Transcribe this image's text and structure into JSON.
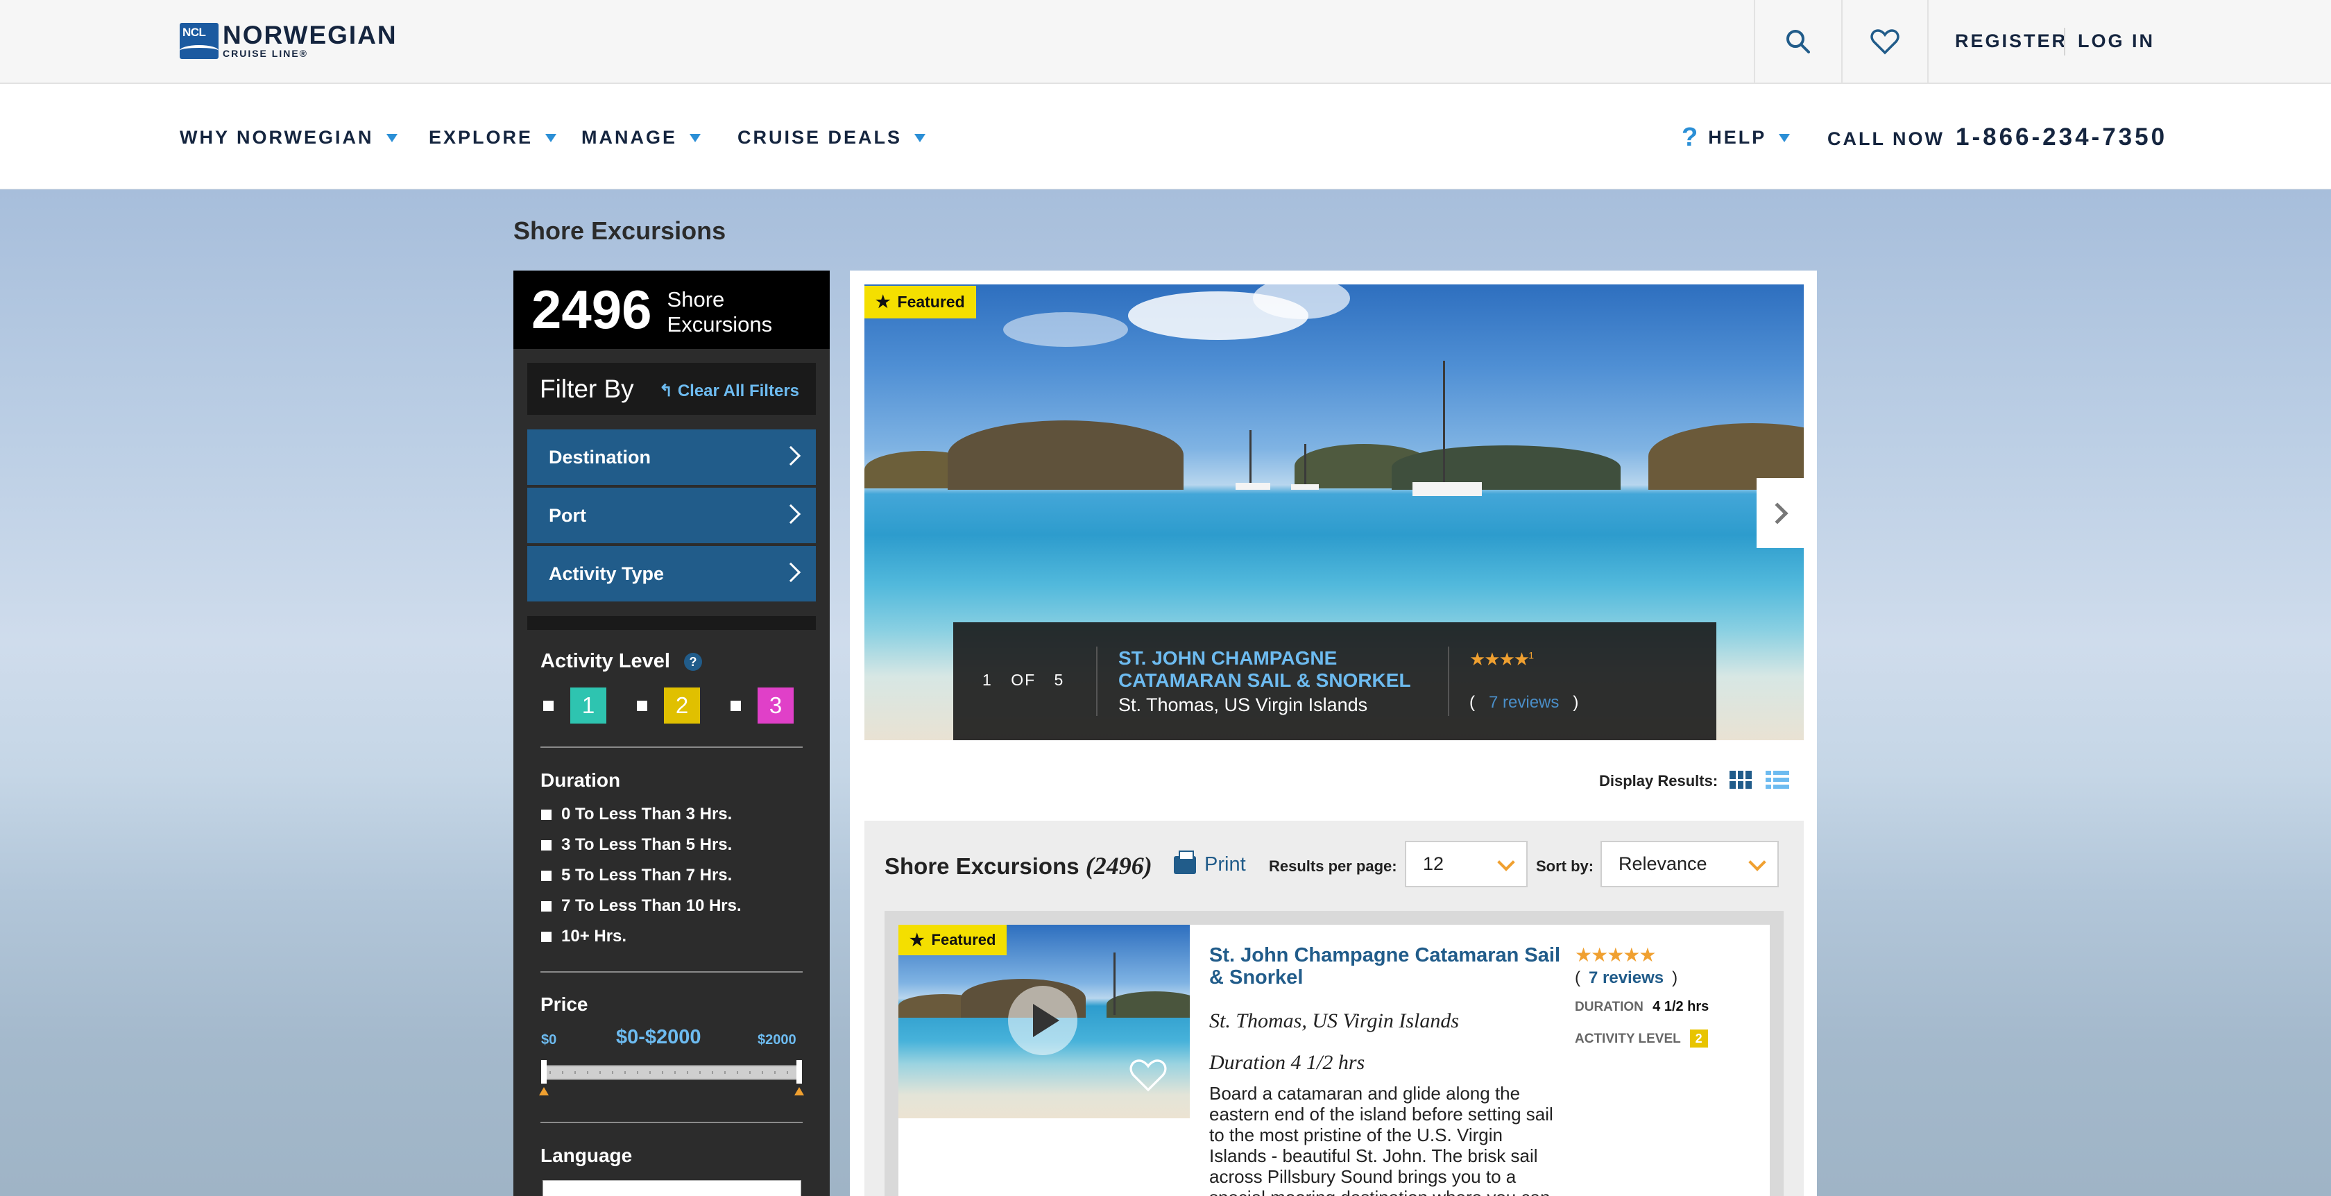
{
  "brand": {
    "badge": "NCL",
    "name": "NORWEGIAN",
    "tagline": "CRUISE LINE®"
  },
  "topbar": {
    "register": "REGISTER",
    "login": "LOG IN"
  },
  "nav": {
    "items": [
      {
        "label": "WHY NORWEGIAN"
      },
      {
        "label": "EXPLORE"
      },
      {
        "label": "MANAGE"
      },
      {
        "label": "CRUISE DEALS"
      }
    ],
    "help": "HELP",
    "call_label": "CALL NOW",
    "phone": "1-866-234-7350"
  },
  "page": {
    "title": "Shore Excursions"
  },
  "sidebar": {
    "count": "2496",
    "count_label": "Shore Excursions",
    "filter_by": "Filter By",
    "clear_all": "Clear All Filters",
    "facets": [
      {
        "label": "Destination"
      },
      {
        "label": "Port"
      },
      {
        "label": "Activity Type"
      }
    ],
    "activity_level": {
      "title": "Activity Level",
      "help": "?",
      "levels": [
        {
          "value": "1",
          "color": "#2ec4b0"
        },
        {
          "value": "2",
          "color": "#e0c000"
        },
        {
          "value": "3",
          "color": "#e040c8"
        }
      ]
    },
    "duration": {
      "title": "Duration",
      "options": [
        {
          "label": "0 To Less Than 3 Hrs."
        },
        {
          "label": "3 To Less Than 5 Hrs."
        },
        {
          "label": "5 To Less Than 7 Hrs."
        },
        {
          "label": "7 To Less Than 10 Hrs."
        },
        {
          "label": "10+ Hrs."
        }
      ]
    },
    "price": {
      "title": "Price",
      "min": "$0",
      "range": "$0-$2000",
      "max": "$2000"
    },
    "language": {
      "title": "Language"
    }
  },
  "hero": {
    "featured": "Featured",
    "position": "1",
    "of": "OF",
    "total": "5",
    "title": "ST. JOHN CHAMPAGNE CATAMARAN SAIL & SNORKEL",
    "location": "St. Thomas, US Virgin Islands",
    "rating_stars": "★★★★",
    "rating_suffix": "1",
    "reviews_open": "(",
    "reviews": "7 reviews",
    "reviews_close": ")"
  },
  "display": {
    "label": "Display Results:"
  },
  "results": {
    "title": "Shore Excursions",
    "count": "(2496)",
    "print": "Print",
    "per_page_label": "Results per page:",
    "per_page_value": "12",
    "sort_label": "Sort by:",
    "sort_value": "Relevance"
  },
  "card": {
    "featured": "Featured",
    "title": "St. John Champagne Catamaran Sail & Snorkel",
    "location": "St. Thomas, US Virgin Islands",
    "duration_text": "Duration 4 1/2 hrs",
    "description": "Board a catamaran and glide along the eastern end of the island before setting sail to the most pristine of the U.S. Virgin Islands - beautiful St. John. The brisk sail across Pillsbury Sound brings you to a special mooring destination where you can",
    "stars": "★★★★★",
    "reviews_open": "(",
    "reviews": "7 reviews",
    "reviews_close": ")",
    "duration_label": "DURATION",
    "duration_value": "4 1/2 hrs",
    "activity_label": "ACTIVITY LEVEL",
    "activity_value": "2"
  },
  "colors": {
    "brand_navy": "#15253f",
    "accent_blue": "#2b8fd6",
    "facet_blue": "#215c8a",
    "featured_yellow": "#f4df00",
    "star_orange": "#f0a030"
  }
}
